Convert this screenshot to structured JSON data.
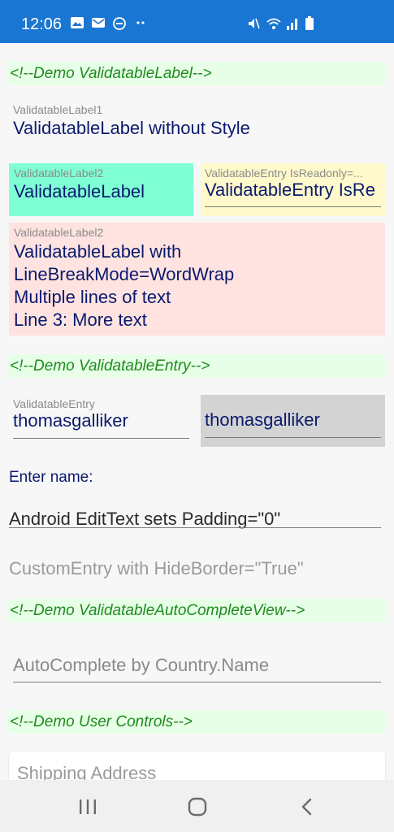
{
  "status_bar": {
    "time": "12:06",
    "left_icons": [
      "image-icon",
      "mail-icon",
      "dnd-icon",
      "more-dots-icon"
    ],
    "right_icons": [
      "mute-icon",
      "wifi-icon",
      "signal-icon",
      "battery-icon"
    ],
    "color": "#1976d2"
  },
  "comments": {
    "label": "<!--Demo ValidatableLabel-->",
    "entry": "<!--Demo ValidatableEntry-->",
    "autocomplete": "<!--Demo ValidatableAutoCompleteView-->",
    "user_controls": "<!--Demo User Controls-->"
  },
  "label1": {
    "caption": "ValidatableLabel1",
    "text": "ValidatableLabel without Style"
  },
  "label2a": {
    "caption": "ValidatableLabel2",
    "text": "ValidatableLabel",
    "bg": "#7fffd4"
  },
  "readonly_entry": {
    "caption": "ValidatableEntry IsReadonly=...",
    "text": "ValidatableEntry IsRe",
    "bg": "#fff9cc"
  },
  "label2b": {
    "caption": "ValidatableLabel2",
    "lines": [
      "ValidatableLabel with",
      "LineBreakMode=WordWrap",
      "Multiple lines of text",
      "Line 3: More text"
    ],
    "bg": "#ffe3e0"
  },
  "validatable_entry": {
    "caption": "ValidatableEntry",
    "value": "thomasgalliker"
  },
  "disabled_entry": {
    "value": "thomasgalliker",
    "bg": "#d3d3d3"
  },
  "enter_name": "Enter name:",
  "android_entry": {
    "value": "Android EditText sets Padding=\"0\""
  },
  "custom_entry": {
    "placeholder": "CustomEntry with HideBorder=\"True\""
  },
  "autocomplete": {
    "placeholder": "AutoComplete by Country.Name"
  },
  "shipping": {
    "placeholder": "Shipping Address"
  },
  "nav": {
    "recents_icon": "recents-icon",
    "home_icon": "home-icon",
    "back_icon": "back-icon"
  }
}
